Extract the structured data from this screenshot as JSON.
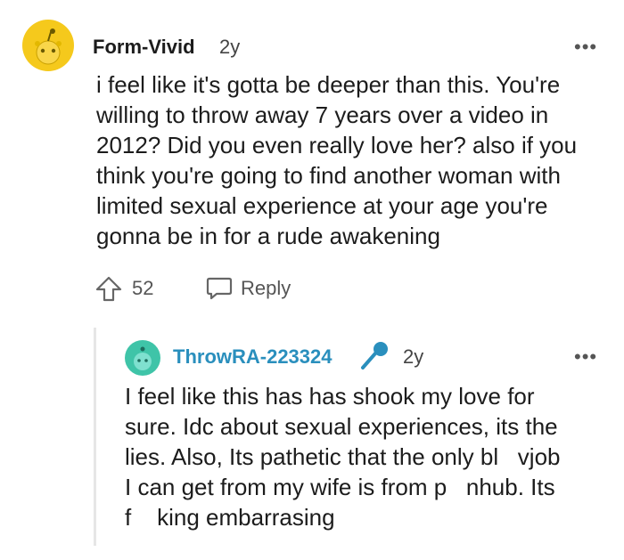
{
  "comment": {
    "username": "Form-Vivid",
    "age": "2y",
    "avatar_color": "#f5c91c",
    "lines": [
      "i feel like it's gotta be deeper than this. You're",
      "willing to throw away 7 years over a video in",
      "2012? Did you even really love her? also if you",
      "think you're going to find another woman with",
      "limited sexual experience at your age you're",
      "gonna be in for a rude awakening"
    ],
    "upvotes": "52",
    "reply_label": "Reply",
    "more_icon": "more-dots-icon"
  },
  "reply": {
    "username": "ThrowRA-223324",
    "age": "2y",
    "username_color": "#2a8fbd",
    "avatar_color": "#3fc4a8",
    "badge_icon": "microphone-icon",
    "lines": [
      "I feel like this has has shook my love for",
      "sure. Idc about sexual experiences, its the",
      "lies. Also, Its pathetic that the only bl   vjob",
      "I can get from my wife is from p   nhub. Its",
      "f    king embarrasing"
    ],
    "more_icon": "more-dots-icon"
  }
}
